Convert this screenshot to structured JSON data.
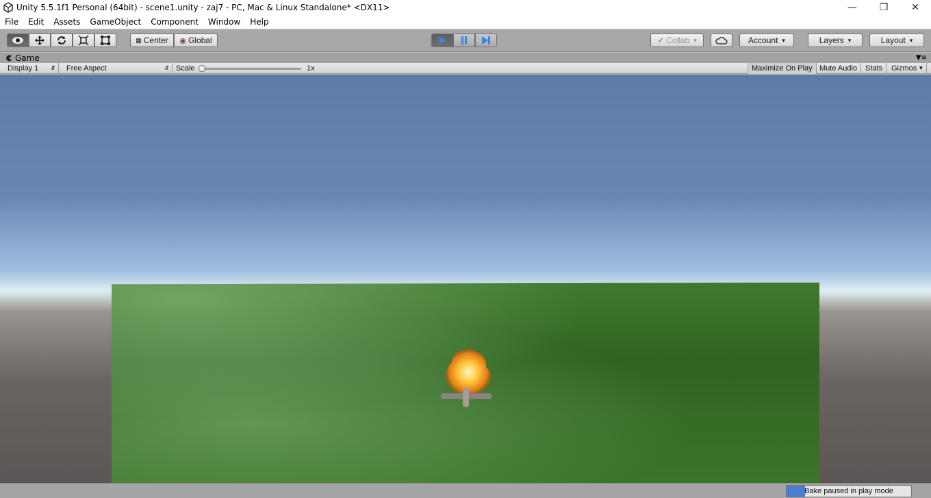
{
  "window": {
    "title": "Unity 5.5.1f1 Personal (64bit) - scene1.unity - zaj7 - PC, Mac & Linux Standalone* <DX11>",
    "controls": [
      "minimize-icon",
      "restore-icon",
      "close-icon"
    ]
  },
  "menu": {
    "file": "File",
    "edit": "Edit",
    "assets": "Assets",
    "gameobject": "GameObject",
    "component": "Component",
    "window": "Window",
    "help": "Help"
  },
  "toolbar": {
    "tools": [
      "view-tool-icon",
      "move-tool-icon",
      "rotate-tool-icon",
      "scale-tool-icon",
      "rect-tool-icon"
    ],
    "pivot_label": "Center",
    "space_label": "Global",
    "collab_label": "Collab",
    "account_label": "Account",
    "layers_label": "Layers",
    "layout_label": "Layout",
    "play_state": "playing-paused"
  },
  "game_panel": {
    "tab_label": "Game",
    "display_label": "Display 1",
    "aspect_label": "Free Aspect",
    "scale_label": "Scale",
    "scale_value": "1x",
    "maximize_label": "Maximize On Play",
    "mute_label": "Mute Audio",
    "stats_label": "Stats",
    "gizmos_label": "Gizmos"
  },
  "status": {
    "bake_label": "Bake paused in play mode",
    "bake_progress": 0.15
  },
  "colors": {
    "accent_play": "#3b87e0",
    "toolbar_bg": "#a8a8a8",
    "sky_top": "#5f7aa5",
    "grass": "#3a742a"
  }
}
